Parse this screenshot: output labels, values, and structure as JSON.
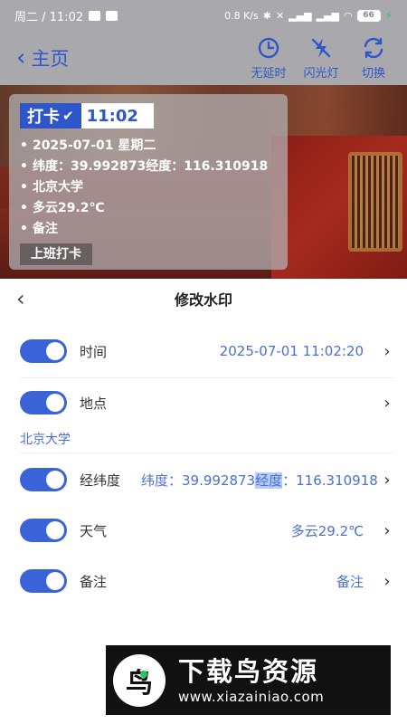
{
  "status_bar": {
    "time": "周二 / 11:02",
    "network": "0.8 K/s",
    "battery": "66"
  },
  "top_bar": {
    "back_label": "主页",
    "actions": [
      {
        "label": "无延时",
        "icon": "timer-icon"
      },
      {
        "label": "闪光灯",
        "icon": "flash-off-icon"
      },
      {
        "label": "切换",
        "icon": "switch-camera-icon"
      }
    ]
  },
  "watermark": {
    "punch_label": "打卡",
    "time": "11:02",
    "lines": [
      "2025-07-01 星期二",
      "纬度：39.992873经度：116.310918",
      "北京大学",
      "多云29.2℃",
      "备注"
    ],
    "tag": "上班打卡"
  },
  "sheet": {
    "title": "修改水印",
    "rows": [
      {
        "label": "时间",
        "value": "2025-07-01 11:02:20",
        "enabled": true
      },
      {
        "label": "地点",
        "value": "",
        "enabled": true
      },
      {
        "label": "经纬度",
        "value_pre": "纬度：39.992873",
        "value_sel": "经度",
        "value_post": "：116.310918",
        "enabled": true
      },
      {
        "label": "天气",
        "value": "多云29.2℃",
        "enabled": true
      },
      {
        "label": "备注",
        "value": "备注",
        "enabled": true
      }
    ],
    "location_sub": "北京大学"
  },
  "ad": {
    "title": "下载鸟资源",
    "url": "www.xiazainiao.com"
  },
  "colors": {
    "accent": "#2f56c9",
    "toggle_on": "#3a63d8",
    "value_text": "#4a6fd6"
  }
}
